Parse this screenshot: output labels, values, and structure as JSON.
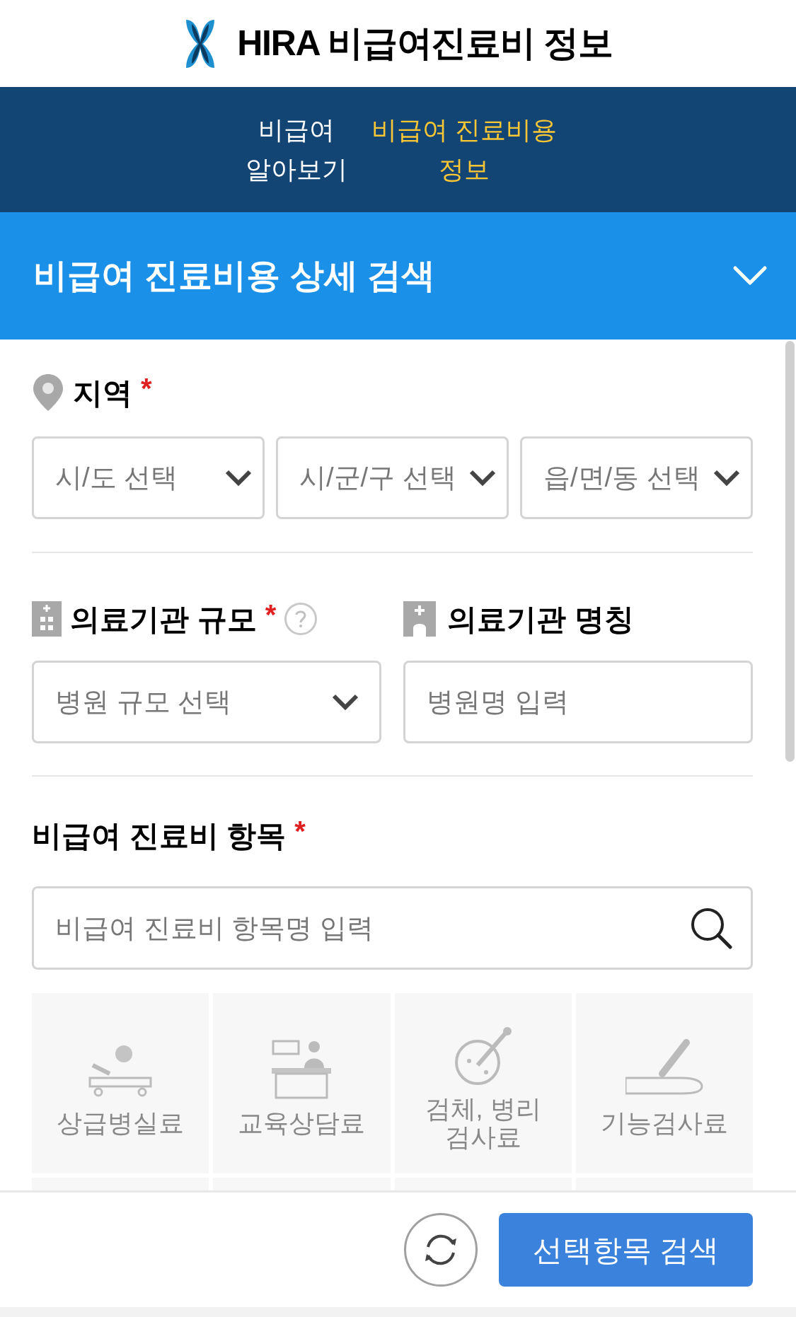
{
  "header": {
    "title": "HIRA 비급여진료비 정보"
  },
  "nav_tabs": [
    {
      "lines": [
        "비급여",
        "알아보기"
      ],
      "selected": false
    },
    {
      "lines": [
        "비급여 진료비용",
        "정보"
      ],
      "selected": true
    }
  ],
  "panel": {
    "title": "비급여 진료비용 상세 검색"
  },
  "region": {
    "label": "지역",
    "required": true,
    "selects": [
      "시/도 선택",
      "시/군/구 선택",
      "읍/면/동 선택"
    ]
  },
  "facility_scale": {
    "label": "의료기관 규모",
    "required": true,
    "select": "병원 규모 선택"
  },
  "facility_name": {
    "label": "의료기관 명칭",
    "placeholder": "병원명 입력"
  },
  "items": {
    "label": "비급여 진료비 항목",
    "required": true,
    "search_placeholder": "비급여 진료비 항목명 입력",
    "categories": [
      {
        "kind": "bed",
        "lines": [
          "상급병실료"
        ]
      },
      {
        "kind": "desk",
        "lines": [
          "교육상담료"
        ]
      },
      {
        "kind": "dish",
        "lines": [
          "검체, 병리",
          "검사료"
        ]
      },
      {
        "kind": "arm",
        "lines": [
          "기능검사료"
        ]
      }
    ]
  },
  "required_mark": "*",
  "footer": {
    "search_button": "선택항목 검색"
  }
}
